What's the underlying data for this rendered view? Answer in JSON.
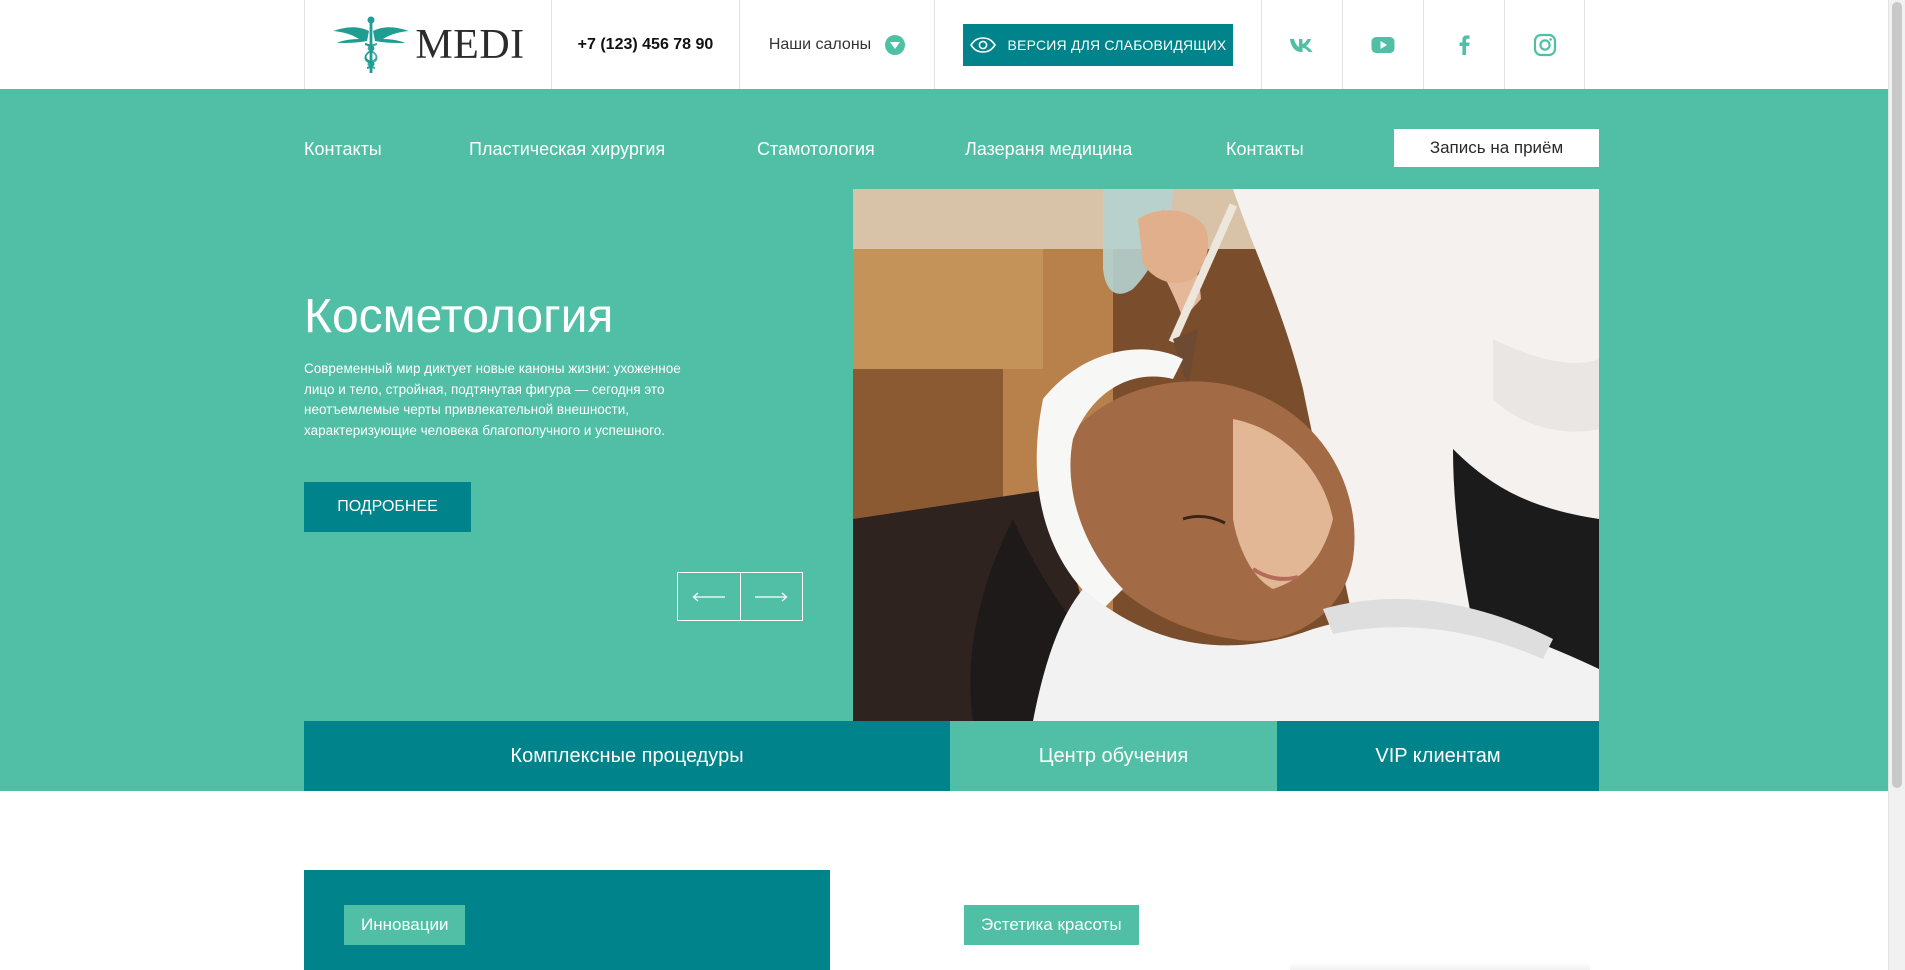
{
  "header": {
    "logo_text": "MEDI",
    "phone": "+7 (123) 456 78 90",
    "salons_label": "Наши салоны",
    "vision_button": "ВЕРСИЯ ДЛЯ СЛАБОВИДЯЩИХ",
    "socials": [
      "vk-icon",
      "youtube-icon",
      "facebook-icon",
      "instagram-icon"
    ]
  },
  "nav": {
    "items": [
      "Контакты",
      "Пластическая хирургия",
      "Стамотология",
      "Лазераня медицина",
      "Контакты"
    ],
    "cta": "Запись на приём"
  },
  "hero": {
    "title": "Косметология",
    "text": "Современный мир диктует новые каноны жизни: ухоженное лицо и тело, стройная, подтянутая фигура — сегодня это неотъемлемые черты привлекательной внешности, характеризующие человека благополучного и успешного.",
    "button": "ПОДРОБНЕЕ"
  },
  "tabs": [
    "Комплексные процедуры",
    "Центр обучения",
    "VIP клиентам"
  ],
  "sections": {
    "innovations": "Инновации",
    "aesthetics": "Эстетика красоты"
  },
  "colors": {
    "accent": "#50bfa5",
    "dark_accent": "#00838a",
    "white": "#ffffff"
  }
}
